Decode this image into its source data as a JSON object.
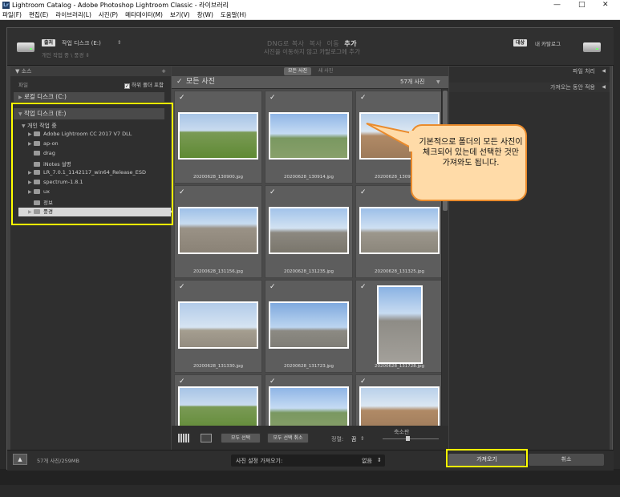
{
  "titlebar": {
    "title": "Lightroom Catalog - Adobe Photoshop Lightroom Classic - 라이브러리",
    "app_icon": "Lr",
    "min": "—",
    "max": "□",
    "close": "✕"
  },
  "menu": [
    "파일(F)",
    "편집(E)",
    "라이브러리(L)",
    "사진(P)",
    "메타데이터(M)",
    "보기(V)",
    "창(W)",
    "도움말(H)"
  ],
  "header": {
    "source_badge": "출처",
    "source_name": "작업 디스크 (E:)",
    "source_arrow": "⇕",
    "source_sub": "개인 작업 중 \\ 풍경 ⇕",
    "ops": [
      "DNG로 복사",
      "복사",
      "이동",
      "추가"
    ],
    "op_sub": "사진을 이동하지 않고 카탈로그에 추가",
    "target_badge": "대상",
    "target_name": "내 카탈로그"
  },
  "left": {
    "panel_title": "소스",
    "add": "+",
    "files_label": "파일",
    "subfolders_label": "하위 폴더 포함",
    "subfolders_checked": "✓",
    "local_disk": "로컬 디스크 (C:)",
    "work_disk": "작업 디스크 (E:)",
    "work_folder": "개인 작업 중",
    "folders": [
      "Adobe Lightroom CC 2017 V7 DLL",
      "ap-on",
      "drag",
      "iNotes 설명",
      "LR_7.0.1_1142117_win64_Release_ESD",
      "spectrum-1.8.1",
      "ux",
      "정보",
      "풍경"
    ]
  },
  "center": {
    "tab_all": "모든 사진",
    "tab_new": "새 사진",
    "grid_title": "모든 사진",
    "grid_count": "57개 사진",
    "files": [
      "20200628_130900.jpg",
      "20200628_130914.jpg",
      "20200628_130920.jpg",
      "20200628_131156.jpg",
      "20200628_131235.jpg",
      "20200628_131325.jpg",
      "20200628_131330.jpg",
      "20200628_131723.jpg",
      "20200628_131728.jpg"
    ],
    "select_all": "모두 선택",
    "deselect_all": "모두 선택 취소",
    "sort_label": "정렬:",
    "sort_value": "끔",
    "thumb_label": "축소판"
  },
  "right": {
    "file_handling": "파일 처리",
    "apply_during_import": "가져오는 동안 적용"
  },
  "footer": {
    "count": "57개 사진/259MB",
    "preset_label": "사진 설정 가져오기:",
    "preset_value": "없음",
    "import": "가져오기",
    "cancel": "취소"
  },
  "callout": {
    "text": "기본적으로 폴더의 모든 사진이 체크되어 있는데 선택한 것만 가져와도 됩니다."
  },
  "colors": {
    "highlight": "#ffff00",
    "callout_border": "#ea8b2c",
    "callout_fill": "#ffdba8"
  }
}
